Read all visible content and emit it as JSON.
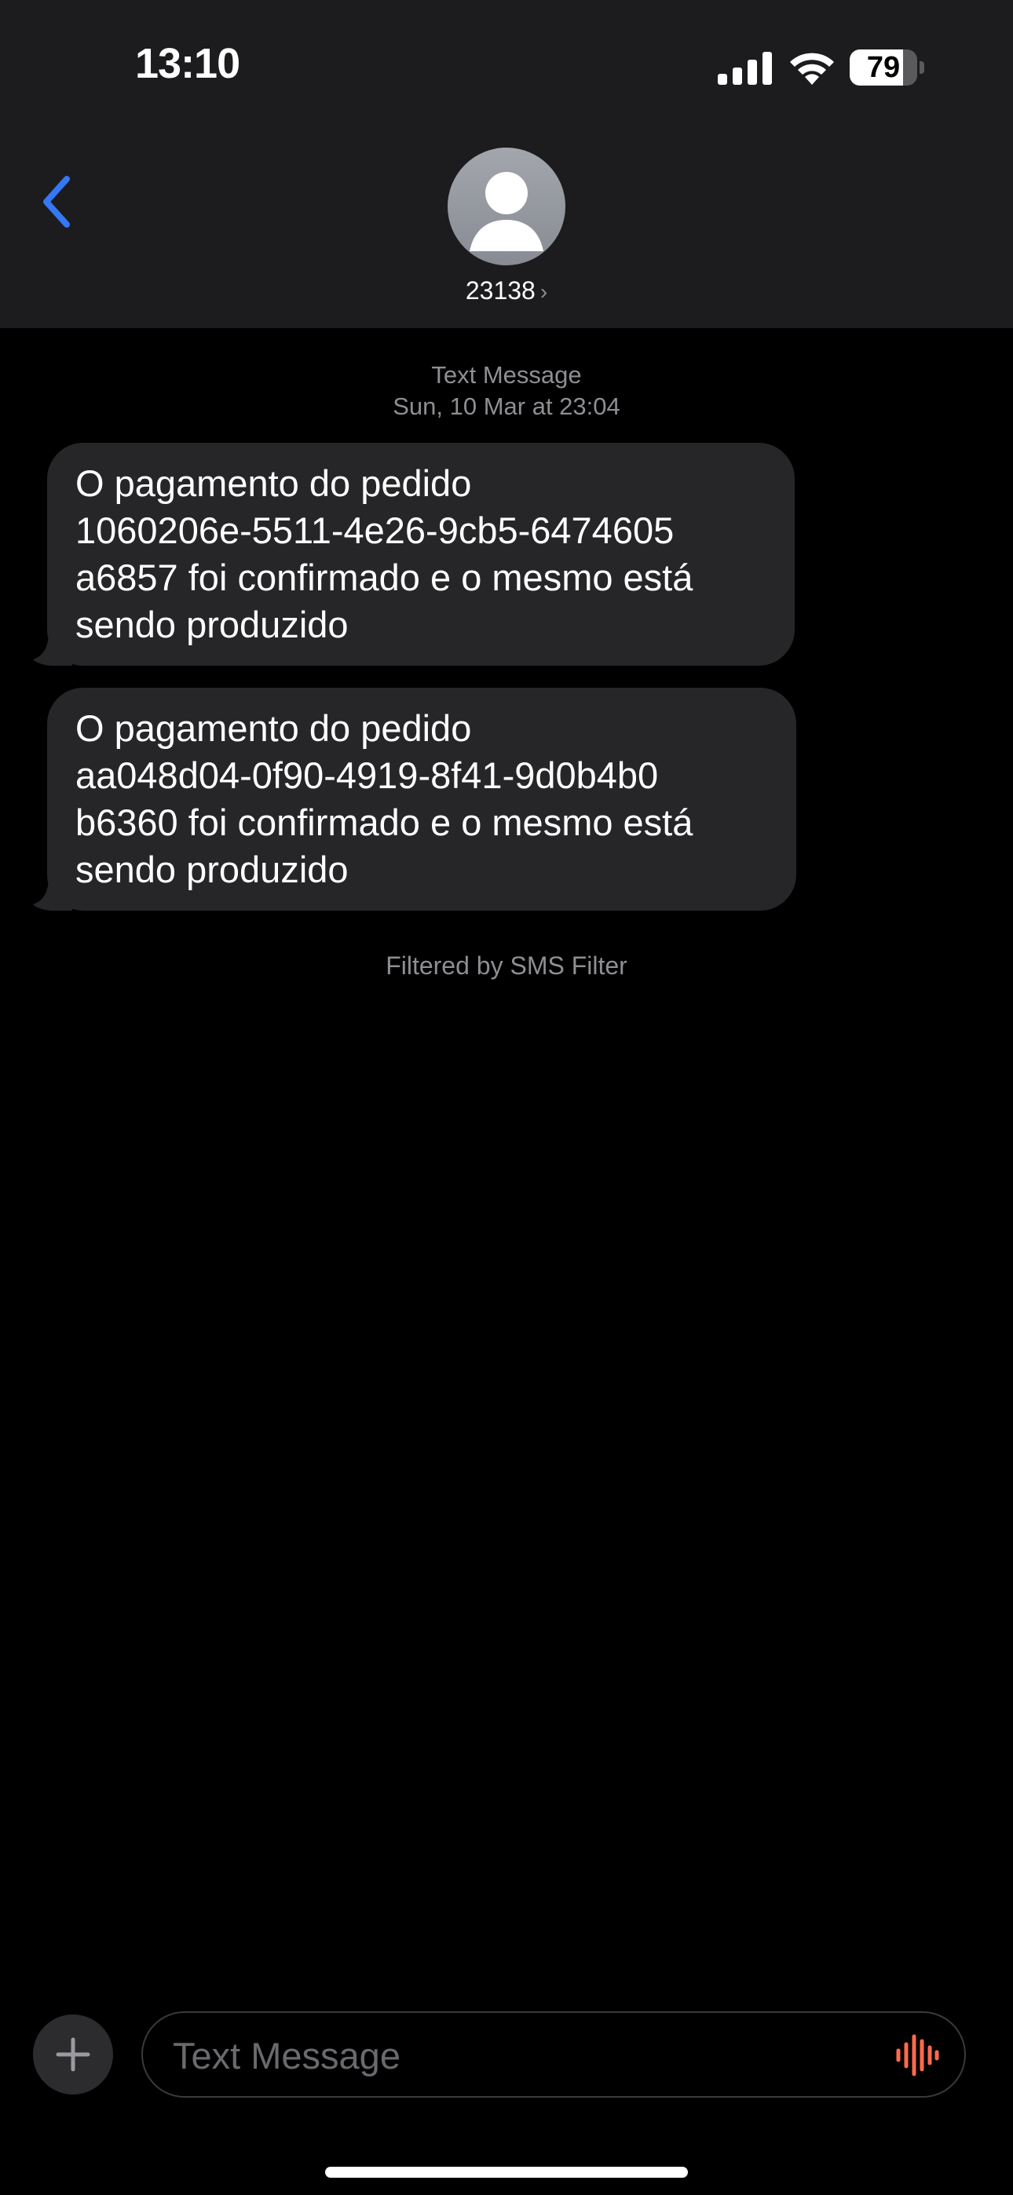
{
  "status_bar": {
    "time": "13:10",
    "battery_level": "79",
    "battery_fraction": 0.79,
    "signal_icon": "cellular-signal-icon",
    "wifi_icon": "wifi-icon",
    "battery_icon": "battery-icon"
  },
  "header": {
    "back_icon": "chevron-left-icon",
    "avatar_icon": "person-silhouette-icon",
    "contact_name": "23138",
    "contact_chevron": "›"
  },
  "conversation": {
    "service_label": "Text Message",
    "date_label": "Sun, 10 Mar at 23:04",
    "messages": [
      {
        "direction": "incoming",
        "lines": [
          "O pagamento do pedido",
          "1060206e-5511-4e26-9cb5-6474605",
          "a6857 foi confirmado e o mesmo está",
          "sendo produzido"
        ]
      },
      {
        "direction": "incoming",
        "lines": [
          "O pagamento do pedido",
          "aa048d04-0f90-4919-8f41-9d0b4b0",
          "b6360 foi confirmado e o mesmo está",
          "sendo produzido"
        ]
      }
    ],
    "filter_note": "Filtered by SMS Filter"
  },
  "composer": {
    "plus_icon": "plus-icon",
    "placeholder": "Text Message",
    "value": "",
    "audio_icon": "audio-waveform-icon"
  },
  "colors": {
    "accent": "#3478f6",
    "header_bg": "#1c1c1e",
    "bubble_incoming": "#262628",
    "audio_icon": "#ff6a4d",
    "secondary_text": "#8e8e93"
  }
}
